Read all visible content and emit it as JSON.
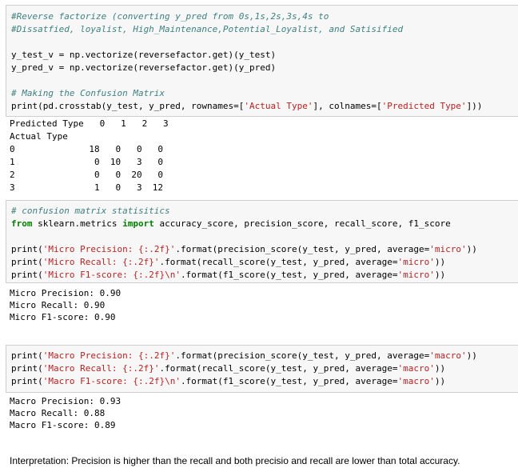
{
  "cell1": {
    "comment1": "#Reverse factorize (converting y_pred from 0s,1s,2s,3s,4s to",
    "comment2": "#Dissatfied, loyalist, High_Maintenance,Potential_Loyalist, and Satisified",
    "line_y_test": "y_test_v = np.vectorize(reversefactor.get)(y_test)",
    "line_y_pred": "y_pred_v = np.vectorize(reversefactor.get)(y_pred)",
    "comment3": "# Making the Confusion Matrix",
    "print_pre": "print(pd.crosstab(y_test, y_pred, rownames=[",
    "print_str1": "'Actual Type'",
    "print_mid": "], colnames=[",
    "print_str2": "'Predicted Type'",
    "print_post": "]))"
  },
  "output1": {
    "header": "Predicted Type   0   1   2   3",
    "index_label": "Actual Type",
    "rows": [
      "0              18   0   0   0",
      "1               0  10   3   0",
      "2               0   0  20   0",
      "3               1   0   3  12"
    ]
  },
  "cell2": {
    "comment": "# confusion matrix statisitics",
    "kw_from": "from",
    "module": " sklearn.metrics ",
    "kw_import": "import",
    "imports": " accuracy_score, precision_score, recall_score, f1_score",
    "lines": [
      {
        "pre": "print(",
        "str": "'Micro Precision: {:.2f}'",
        "mid": ".format(precision_score(y_test, y_pred, average=",
        "arg": "'micro'",
        "post": "))"
      },
      {
        "pre": "print(",
        "str": "'Micro Recall: {:.2f}'",
        "mid": ".format(recall_score(y_test, y_pred, average=",
        "arg": "'micro'",
        "post": "))"
      },
      {
        "pre": "print(",
        "str": "'Micro F1-score: {:.2f}\\n'",
        "mid": ".format(f1_score(y_test, y_pred, average=",
        "arg": "'micro'",
        "post": "))"
      }
    ]
  },
  "output2": [
    "Micro Precision: 0.90",
    "Micro Recall: 0.90",
    "Micro F1-score: 0.90"
  ],
  "cell3": {
    "lines": [
      {
        "pre": "print(",
        "str": "'Macro Precision: {:.2f}'",
        "mid": ".format(precision_score(y_test, y_pred, average=",
        "arg": "'macro'",
        "post": "))"
      },
      {
        "pre": "print(",
        "str": "'Macro Recall: {:.2f}'",
        "mid": ".format(recall_score(y_test, y_pred, average=",
        "arg": "'macro'",
        "post": "))"
      },
      {
        "pre": "print(",
        "str": "'Macro F1-score: {:.2f}\\n'",
        "mid": ".format(f1_score(y_test, y_pred, average=",
        "arg": "'macro'",
        "post": "))"
      }
    ]
  },
  "output3": [
    "Macro Precision: 0.93",
    "Macro Recall: 0.88",
    "Macro F1-score: 0.89"
  ],
  "markdown": {
    "interpretation": "Interpretation: Precision is higher than the recall and both precisio and recall are lower than total accuracy."
  }
}
